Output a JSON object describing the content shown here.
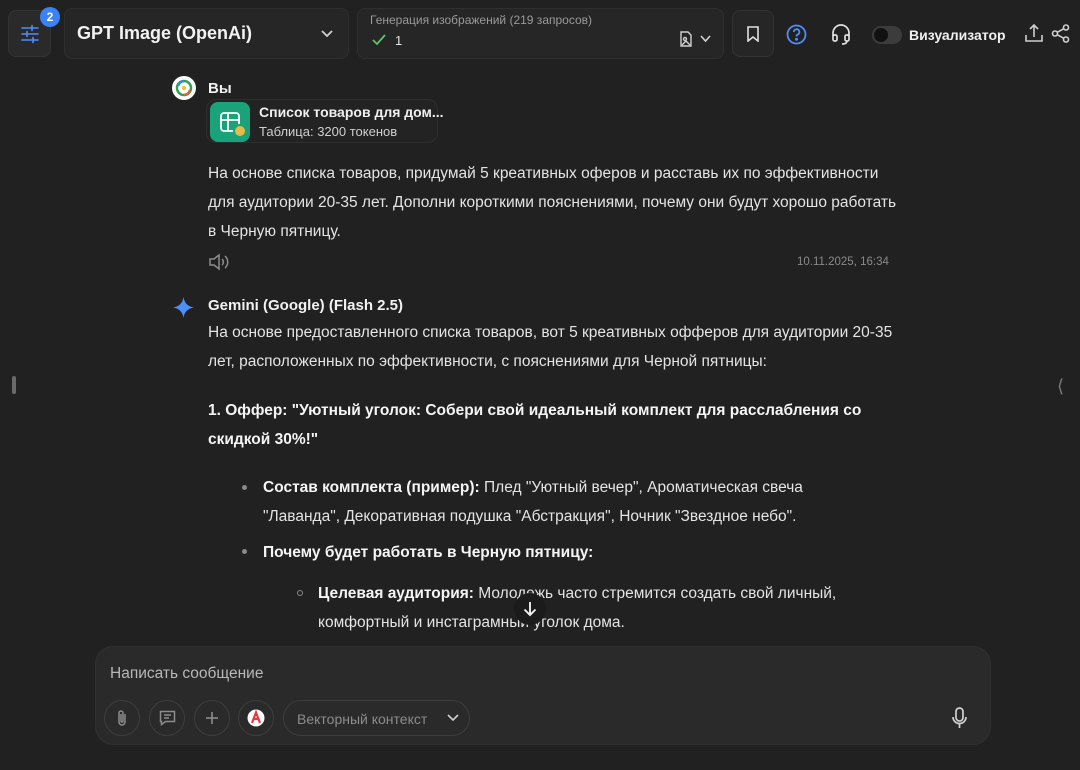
{
  "header": {
    "badge_count": "2",
    "model_name": "GPT Image (OpenAi)",
    "generation_title": "Генерация изображений (219 запросов)",
    "generation_count": "1",
    "visualizer_label": "Визуализатор"
  },
  "user_message": {
    "author": "Вы",
    "attachment_title": "Список товаров для дом...",
    "attachment_subtitle": "Таблица: 3200 токенов",
    "text": "На основе списка товаров, придумай 5 креативных оферов и расставь их по эффективности для аудитории 20-35 лет. Дополни короткими пояснениями, почему они будут хорошо работать в Черную пятницу.",
    "timestamp": "10.11.2025, 16:34"
  },
  "assistant_message": {
    "author": "Gemini (Google) (Flash 2.5)",
    "intro": "На основе предоставленного списка товаров, вот 5 креативных офферов для аудитории 20-35 лет, расположенных по эффективности, с пояснениями для Черной пятницы:",
    "offer_heading": "1. Оффер: \"Уютный уголок: Собери свой идеальный комплект для расслабления со скидкой 30%!\"",
    "item1_label": "Состав комплекта (пример):",
    "item1_text": " Плед \"Уютный вечер\", Ароматическая свеча \"Лаванда\", Декоративная подушка \"Абстракция\", Ночник \"Звездное небо\".",
    "item2_label": "Почему будет работать в Черную пятницу:",
    "sub1_label": "Целевая аудитория:",
    "sub1_text": " Молодежь часто стремится создать свой личный, комфортный и инстаграмный уголок дома."
  },
  "composer": {
    "placeholder": "Написать сообщение",
    "vector_context": "Векторный контекст"
  },
  "icons": [
    "settings-sliders-icon",
    "chevron-down-icon",
    "check-icon",
    "file-image-icon",
    "bookmark-icon",
    "help-icon",
    "headset-icon",
    "share-icon",
    "connect-icon",
    "speaker-icon",
    "gemini-star-icon",
    "arrow-down-icon",
    "attach-icon",
    "prompt-icon",
    "plus-icon",
    "mic-icon"
  ],
  "colors": {
    "background": "#212121",
    "accent": "#3b82f6",
    "table_icon": "#1aa37a"
  }
}
